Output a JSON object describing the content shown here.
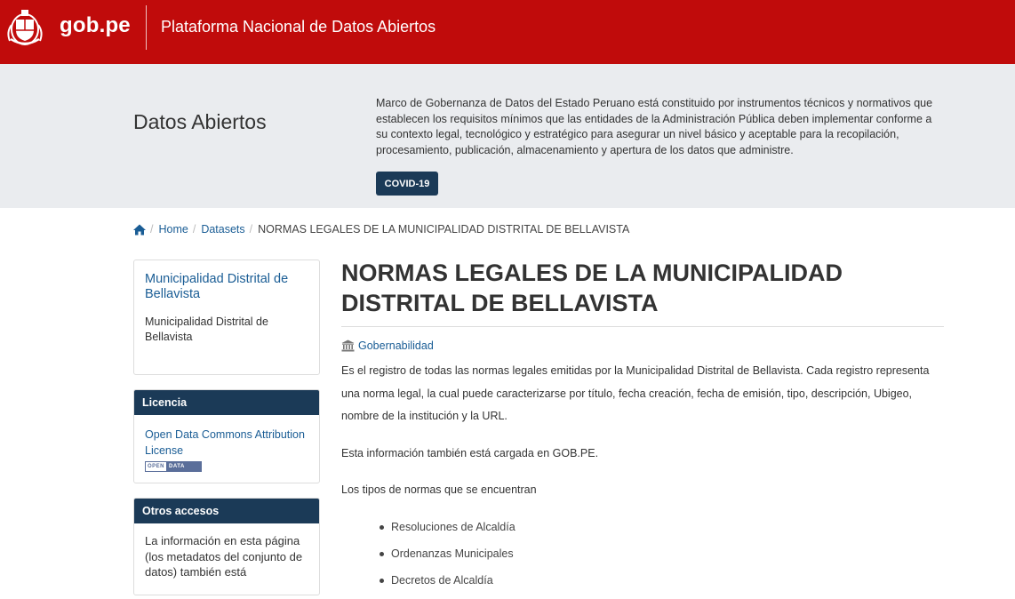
{
  "header": {
    "brand": "gob.pe",
    "platform": "Plataforma Nacional de Datos Abiertos",
    "brand_color": "#c00b0b"
  },
  "hero": {
    "title": "Datos Abiertos",
    "description": "Marco de Gobernanza de Datos del Estado Peruano está constituido por instrumentos técnicos y normativos que establecen los requisitos mínimos que las entidades de la Administración Pública deben implementar conforme a su contexto legal, tecnológico y estratégico para asegurar un nivel básico y aceptable para la recopilación, procesamiento, publicación, almacenamiento y apertura de los datos que administre.",
    "button": "COVID-19",
    "button_color": "#1b3a57"
  },
  "breadcrumb": {
    "icon": "home-icon",
    "items": [
      "Home",
      "Datasets"
    ],
    "current": "NORMAS LEGALES DE LA MUNICIPALIDAD DISTRITAL DE BELLAVISTA"
  },
  "sidebar": {
    "org": {
      "name": "Municipalidad Distrital de Bellavista",
      "description": "Municipalidad Distrital de Bellavista"
    },
    "license": {
      "heading": "Licencia",
      "link": "Open Data Commons Attribution License",
      "badge_left": "OPEN",
      "badge_right": "DATA"
    },
    "access": {
      "heading": "Otros accesos",
      "text": "La información en esta página (los metadatos del conjunto de datos) también está"
    }
  },
  "main": {
    "title": "NORMAS LEGALES DE LA MUNICIPALIDAD DISTRITAL DE BELLAVISTA",
    "topic": "Gobernabilidad",
    "topic_icon": "institution-icon",
    "paragraph1": "Es el registro de todas las normas legales emitidas por la Municipalidad Distrital de Bellavista. Cada registro representa una norma legal, la cual puede caracterizarse por título, fecha creación, fecha de emisión, tipo, descripción, Ubigeo, nombre de la institución y la URL.",
    "paragraph2": "Esta información también está cargada en GOB.PE.",
    "paragraph3": "Los tipos de normas que se encuentran",
    "norm_types": [
      "Resoluciones de Alcaldía",
      "Ordenanzas Municipales",
      "Decretos de Alcaldía"
    ]
  }
}
